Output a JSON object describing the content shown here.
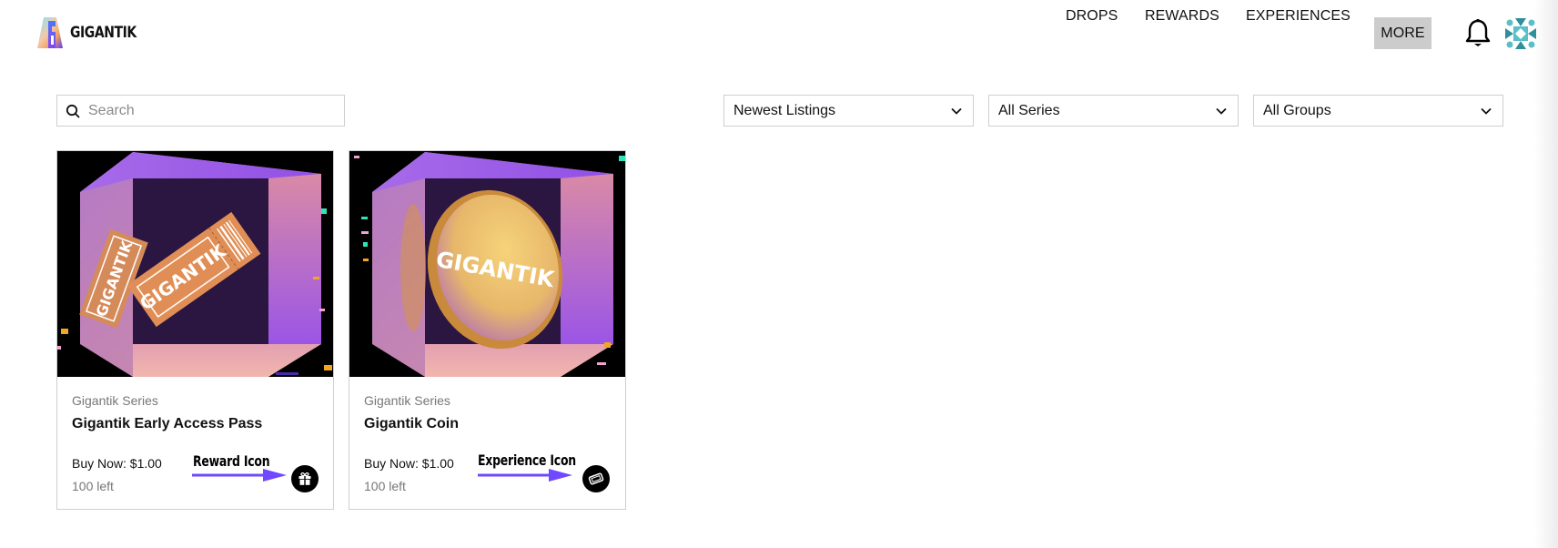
{
  "header": {
    "brand": "GIGANTIK",
    "nav": [
      {
        "label": "DROPS"
      },
      {
        "label": "REWARDS"
      },
      {
        "label": "EXPERIENCES"
      },
      {
        "label": "MORE",
        "active": true
      }
    ],
    "icons": {
      "notifications": "bell-icon",
      "profile": "avatar-identicon"
    }
  },
  "filters": {
    "search": {
      "placeholder": "Search",
      "value": "",
      "icon": "search-icon"
    },
    "sort": {
      "selected": "Newest Listings"
    },
    "series": {
      "selected": "All Series"
    },
    "groups": {
      "selected": "All Groups"
    }
  },
  "listings": [
    {
      "series": "Gigantik Series",
      "title": "Gigantik Early Access Pass",
      "price": "Buy Now: $1.00",
      "stock": "100 left",
      "image_label": "GIGANTIK",
      "image_subject": "ticket in cube",
      "type_icon": "gift-icon",
      "annotation": "Reward Icon"
    },
    {
      "series": "Gigantik Series",
      "title": "Gigantik Coin",
      "price": "Buy Now: $1.00",
      "stock": "100 left",
      "image_label": "GIGANTIK",
      "image_subject": "coin in cube",
      "type_icon": "ticket-icon",
      "annotation": "Experience Icon"
    }
  ],
  "colors": {
    "annotation_arrow": "#7048ff",
    "cube_purple": "#9a5ae6",
    "more_bg": "#cccccc",
    "avatar_teal": "#2f8f9a"
  }
}
